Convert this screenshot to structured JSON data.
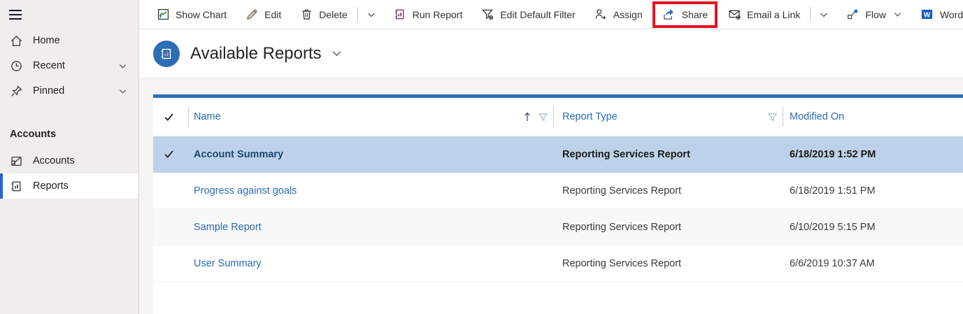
{
  "sidebar": {
    "nav": [
      {
        "label": "Home",
        "chevron": false
      },
      {
        "label": "Recent",
        "chevron": true
      },
      {
        "label": "Pinned",
        "chevron": true
      }
    ],
    "group_label": "Accounts",
    "entities": [
      {
        "label": "Accounts",
        "selected": false
      },
      {
        "label": "Reports",
        "selected": true
      }
    ]
  },
  "toolbar": {
    "items": [
      {
        "label": "Show Chart"
      },
      {
        "label": "Edit"
      },
      {
        "label": "Delete"
      },
      {
        "label": "Run Report"
      },
      {
        "label": "Edit Default Filter"
      },
      {
        "label": "Assign"
      },
      {
        "label": "Share",
        "highlighted": true
      },
      {
        "label": "Email a Link"
      },
      {
        "label": "Flow"
      },
      {
        "label": "Word Templates"
      }
    ]
  },
  "header": {
    "title": "Available Reports"
  },
  "table": {
    "columns": [
      {
        "label": "Name",
        "sorted": "ascending",
        "filter": true
      },
      {
        "label": "Report Type",
        "filter": true
      },
      {
        "label": "Modified On",
        "filter": false
      }
    ],
    "rows": [
      {
        "name": "Account Summary",
        "type": "Reporting Services Report",
        "modified": "6/18/2019 1:52 PM",
        "selected": true
      },
      {
        "name": "Progress against goals",
        "type": "Reporting Services Report",
        "modified": "6/18/2019 1:51 PM",
        "selected": false
      },
      {
        "name": "Sample Report",
        "type": "Reporting Services Report",
        "modified": "6/10/2019 5:15 PM",
        "selected": false
      },
      {
        "name": "User Summary",
        "type": "Reporting Services Report",
        "modified": "6/6/2019 10:37 AM",
        "selected": false
      }
    ]
  },
  "icons": {
    "word_glyph": "W"
  },
  "colors": {
    "highlight_box": "#e3131f",
    "selected_row": "#bdd2ea",
    "grid_top_bar": "#2a70b9",
    "link_blue": "#2b6cb0",
    "sidebar_selected_bar": "#2266d2",
    "title_circle": "#2e6db5",
    "sidebar_bg": "#efeeec"
  }
}
